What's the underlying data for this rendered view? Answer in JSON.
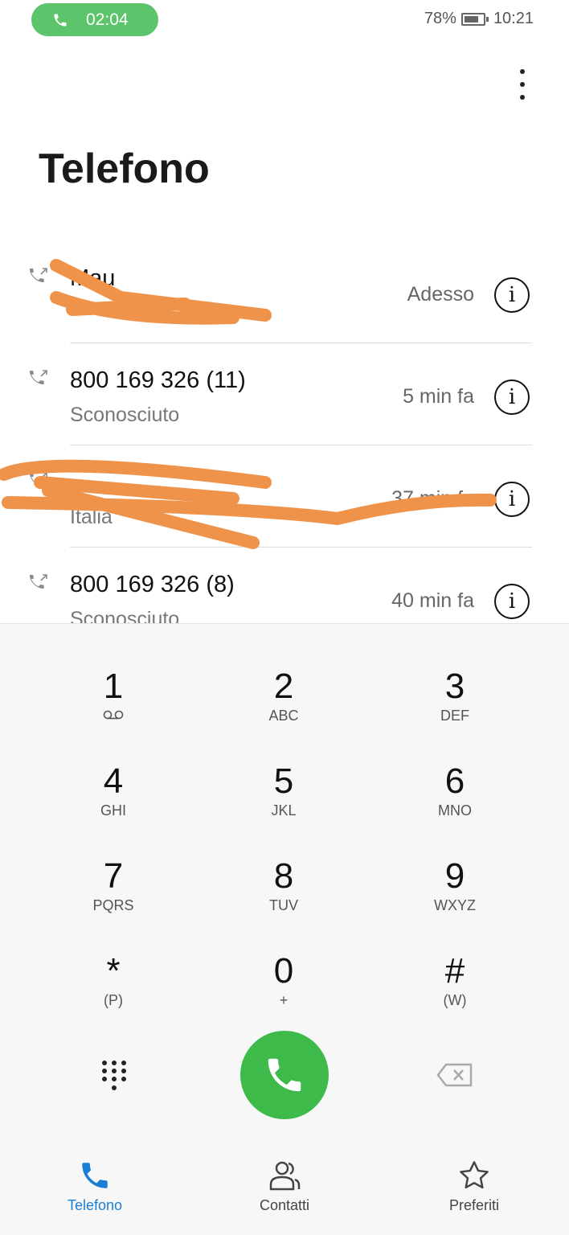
{
  "status_bar": {
    "call_timer": "02:04",
    "battery": "78%",
    "battery_level": 0.78,
    "time": "10:21"
  },
  "header": {
    "title": "Telefono",
    "menu_icon": "more-vert-icon"
  },
  "calls": [
    {
      "name": "Mau",
      "subtitle": "",
      "time": "Adesso",
      "icon": "outgoing-call-icon"
    },
    {
      "name": "800 169 326 (11)",
      "subtitle": "Sconosciuto",
      "time": "5 min fa",
      "icon": "outgoing-call-icon"
    },
    {
      "name": "",
      "subtitle": "Italia",
      "time": "37 min fa",
      "icon": "outgoing-call-icon"
    },
    {
      "name": "800 169 326 (8)",
      "subtitle": "Sconosciuto",
      "time": "40 min fa",
      "icon": "outgoing-call-icon"
    }
  ],
  "keypad": [
    {
      "digit": "1",
      "letters": "voicemail"
    },
    {
      "digit": "2",
      "letters": "ABC"
    },
    {
      "digit": "3",
      "letters": "DEF"
    },
    {
      "digit": "4",
      "letters": "GHI"
    },
    {
      "digit": "5",
      "letters": "JKL"
    },
    {
      "digit": "6",
      "letters": "MNO"
    },
    {
      "digit": "7",
      "letters": "PQRS"
    },
    {
      "digit": "8",
      "letters": "TUV"
    },
    {
      "digit": "9",
      "letters": "WXYZ"
    },
    {
      "digit": "*",
      "letters": "(P)"
    },
    {
      "digit": "0",
      "letters": "+"
    },
    {
      "digit": "#",
      "letters": "(W)"
    }
  ],
  "nav": {
    "tabs": [
      {
        "label": "Telefono",
        "active": true
      },
      {
        "label": "Contatti"
      },
      {
        "label": "Preferiti"
      }
    ]
  },
  "colors": {
    "accent": "#1a7fd4",
    "call_green": "#3dba4a",
    "redaction": "#f0934a"
  }
}
